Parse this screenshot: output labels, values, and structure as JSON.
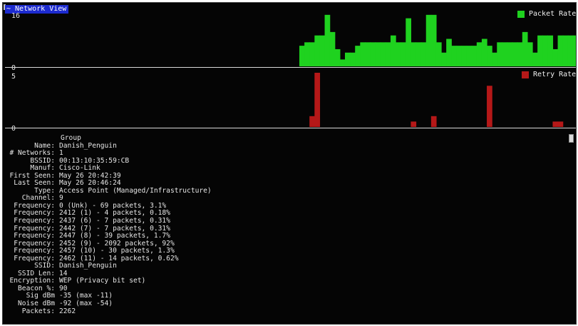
{
  "window": {
    "title": "~ Network View"
  },
  "charts": {
    "packet": {
      "y_max_label": "16",
      "y_min_label": "0",
      "legend_label": "Packet Rate",
      "color": "#1fd21f"
    },
    "retry": {
      "y_max_label": "5",
      "y_min_label": "0",
      "legend_label": "Retry Rate",
      "color": "#b51818"
    }
  },
  "chart_data": [
    {
      "type": "bar",
      "series": [
        {
          "name": "Packet Rate",
          "values": [
            6,
            7,
            7,
            9,
            9,
            15,
            10,
            5,
            2,
            4,
            4,
            6,
            7,
            7,
            7,
            7,
            7,
            7,
            9,
            7,
            7,
            14,
            7,
            7,
            7,
            15,
            15,
            7,
            4,
            8,
            6,
            6,
            6,
            6,
            6,
            7,
            8,
            6,
            4,
            7,
            7,
            7,
            7,
            7,
            10,
            7,
            4,
            9,
            9,
            9,
            5,
            9,
            9,
            9,
            9
          ]
        }
      ],
      "ylim": [
        0,
        16
      ]
    },
    {
      "type": "bar",
      "series": [
        {
          "name": "Retry Rate",
          "values": [
            0,
            0,
            1,
            5,
            0,
            0,
            0,
            0,
            0,
            0,
            0,
            0,
            0,
            0,
            0,
            0,
            0,
            0,
            0,
            0,
            0,
            0,
            0.5,
            0,
            0,
            0,
            1,
            0,
            0,
            0,
            0,
            0,
            0,
            0,
            0,
            0,
            0,
            3.8,
            0,
            0,
            0,
            0,
            0,
            0,
            0,
            0,
            0,
            0,
            0,
            0,
            0.5,
            0.5,
            0,
            0,
            0
          ]
        }
      ],
      "ylim": [
        0,
        5
      ]
    }
  ],
  "info": {
    "heading": "Group",
    "rows": [
      {
        "key": "Name:",
        "value": "Danish_Penguin"
      },
      {
        "key": "# Networks:",
        "value": "1"
      },
      {
        "key": "BSSID:",
        "value": "00:13:10:35:59:CB"
      },
      {
        "key": "Manuf:",
        "value": "Cisco-Link"
      },
      {
        "key": "First Seen:",
        "value": "May 26 20:42:39"
      },
      {
        "key": "Last Seen:",
        "value": "May 26 20:46:24"
      },
      {
        "key": "Type:",
        "value": "Access Point (Managed/Infrastructure)"
      },
      {
        "key": "Channel:",
        "value": "9"
      },
      {
        "key": "Frequency:",
        "value": "0 (Unk) - 69 packets, 3.1%"
      },
      {
        "key": "Frequency:",
        "value": "2412 (1) - 4 packets, 0.18%"
      },
      {
        "key": "Frequency:",
        "value": "2437 (6) - 7 packets, 0.31%"
      },
      {
        "key": "Frequency:",
        "value": "2442 (7) - 7 packets, 0.31%"
      },
      {
        "key": "Frequency:",
        "value": "2447 (8) - 39 packets, 1.7%"
      },
      {
        "key": "Frequency:",
        "value": "2452 (9) - 2092 packets, 92%"
      },
      {
        "key": "Frequency:",
        "value": "2457 (10) - 30 packets, 1.3%"
      },
      {
        "key": "Frequency:",
        "value": "2462 (11) - 14 packets, 0.62%"
      },
      {
        "key": "SSID:",
        "value": "Danish_Penguin"
      },
      {
        "key": "SSID Len:",
        "value": "14"
      },
      {
        "key": "Encryption:",
        "value": "WEP (Privacy bit set)"
      },
      {
        "key": "Beacon %:",
        "value": "90"
      },
      {
        "key": "Sig dBm",
        "value": "-35 (max -11)"
      },
      {
        "key": "Noise dBm",
        "value": "-92 (max -54)"
      },
      {
        "key": "Packets:",
        "value": "2262"
      }
    ]
  }
}
